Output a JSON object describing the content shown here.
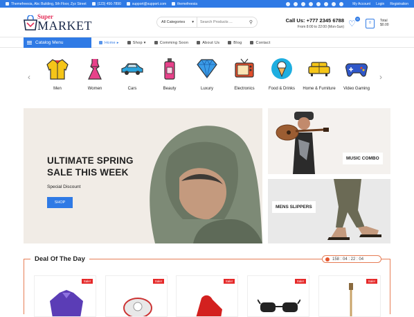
{
  "topbar": {
    "address": "Themefreesia, Abc Building, 5th Floor, Zyz Street",
    "phone": "(123) 456-7890",
    "email": "support@support.com",
    "skype": "themefreesia",
    "links": [
      "My Account",
      "Login",
      "Registration"
    ]
  },
  "logo": {
    "super": "Super",
    "market": "MARKET"
  },
  "search": {
    "category": "All Categories",
    "placeholder": "Search Products ..."
  },
  "contact": {
    "call": "Call Us: +777 2345 6788",
    "hours": "From 8:00 to 22:00 (Mon-Sun)"
  },
  "wishlist": {
    "count": "0"
  },
  "cart": {
    "count": "0",
    "total_label": "Total",
    "total_value": "$0.00"
  },
  "nav": {
    "catalog": "Catalog Menu",
    "items": [
      {
        "label": "Home",
        "active": true,
        "caret": "▸"
      },
      {
        "label": "Shop",
        "caret": "▾"
      },
      {
        "label": "Comming Soon"
      },
      {
        "label": "About Us"
      },
      {
        "label": "Blog"
      },
      {
        "label": "Contact"
      }
    ]
  },
  "categories": [
    {
      "label": "Men",
      "icon": "jacket-icon"
    },
    {
      "label": "Women",
      "icon": "dress-icon"
    },
    {
      "label": "Cars",
      "icon": "car-icon"
    },
    {
      "label": "Beauty",
      "icon": "perfume-icon"
    },
    {
      "label": "Luxury",
      "icon": "diamond-icon"
    },
    {
      "label": "Electronics",
      "icon": "tv-icon"
    },
    {
      "label": "Food & Drinks",
      "icon": "ice-cream-icon"
    },
    {
      "label": "Home & Furniture",
      "icon": "sofa-icon"
    },
    {
      "label": "Video Gaming",
      "icon": "gamepad-icon"
    }
  ],
  "hero": {
    "line1": "ULTIMATE SPRING",
    "line2": "SALE THIS WEEK",
    "sub": "Special Discount",
    "button": "SHOP"
  },
  "promos": {
    "music": "MUSIC COMBO",
    "slippers": "MENS SLIPPERS"
  },
  "deal": {
    "title": "Deal Of The Day",
    "timer": "158 : 04 : 22 : 04",
    "sale_badge": "Sale!"
  },
  "colors": {
    "accent": "#2f7ae5",
    "deal_border": "#e67c54",
    "sale": "#e52929"
  }
}
